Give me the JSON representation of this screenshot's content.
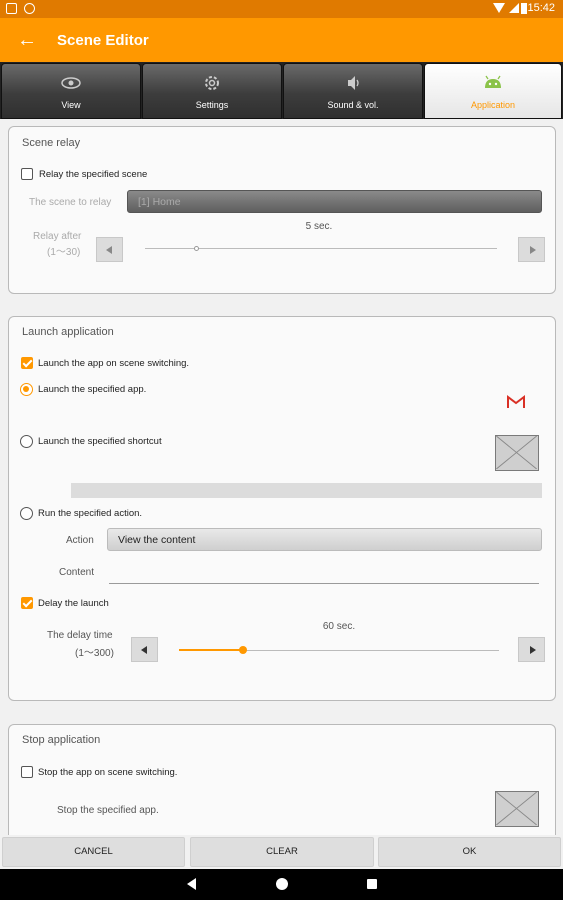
{
  "status_bar": {
    "time": "15:42"
  },
  "app_bar": {
    "title": "Scene Editor"
  },
  "tabs": [
    {
      "label": "View",
      "icon": "eye-icon",
      "active": false
    },
    {
      "label": "Settings",
      "icon": "gear-icon",
      "active": false
    },
    {
      "label": "Sound & vol.",
      "icon": "speaker-icon",
      "active": false
    },
    {
      "label": "Application",
      "icon": "android-icon",
      "active": true
    }
  ],
  "scene_relay": {
    "title": "Scene relay",
    "relay_checkbox_label": "Relay the specified scene",
    "relay_checked": false,
    "scene_label": "The scene to relay",
    "scene_value": "[1] Home",
    "relay_after_label": "Relay after",
    "relay_after_range": "(1〜30)",
    "relay_after_value": "5 sec.",
    "relay_after_fraction": 0.14
  },
  "launch_app": {
    "title": "Launch application",
    "launch_checkbox_label": "Launch the app on scene switching.",
    "launch_checked": true,
    "opt_app_label": "Launch the specified app.",
    "opt_shortcut_label": "Launch the specified shortcut",
    "opt_action_label": "Run the specified action.",
    "selected_option": "app",
    "action_label": "Action",
    "action_value": "View the content",
    "content_label": "Content",
    "content_value": "",
    "delay_checkbox_label": "Delay the launch",
    "delay_checked": true,
    "delay_time_label": "The delay time",
    "delay_time_range": "(1〜300)",
    "delay_value": "60 sec.",
    "delay_fraction": 0.2,
    "app_icon": "gmail-icon",
    "accent_color": "#ff9800"
  },
  "stop_app": {
    "title": "Stop application",
    "stop_checkbox_label": "Stop the app on scene switching.",
    "stop_checked": false,
    "stop_specified_label": "Stop the specified app."
  },
  "buttons": {
    "cancel": "CANCEL",
    "clear": "CLEAR",
    "ok": "OK"
  }
}
